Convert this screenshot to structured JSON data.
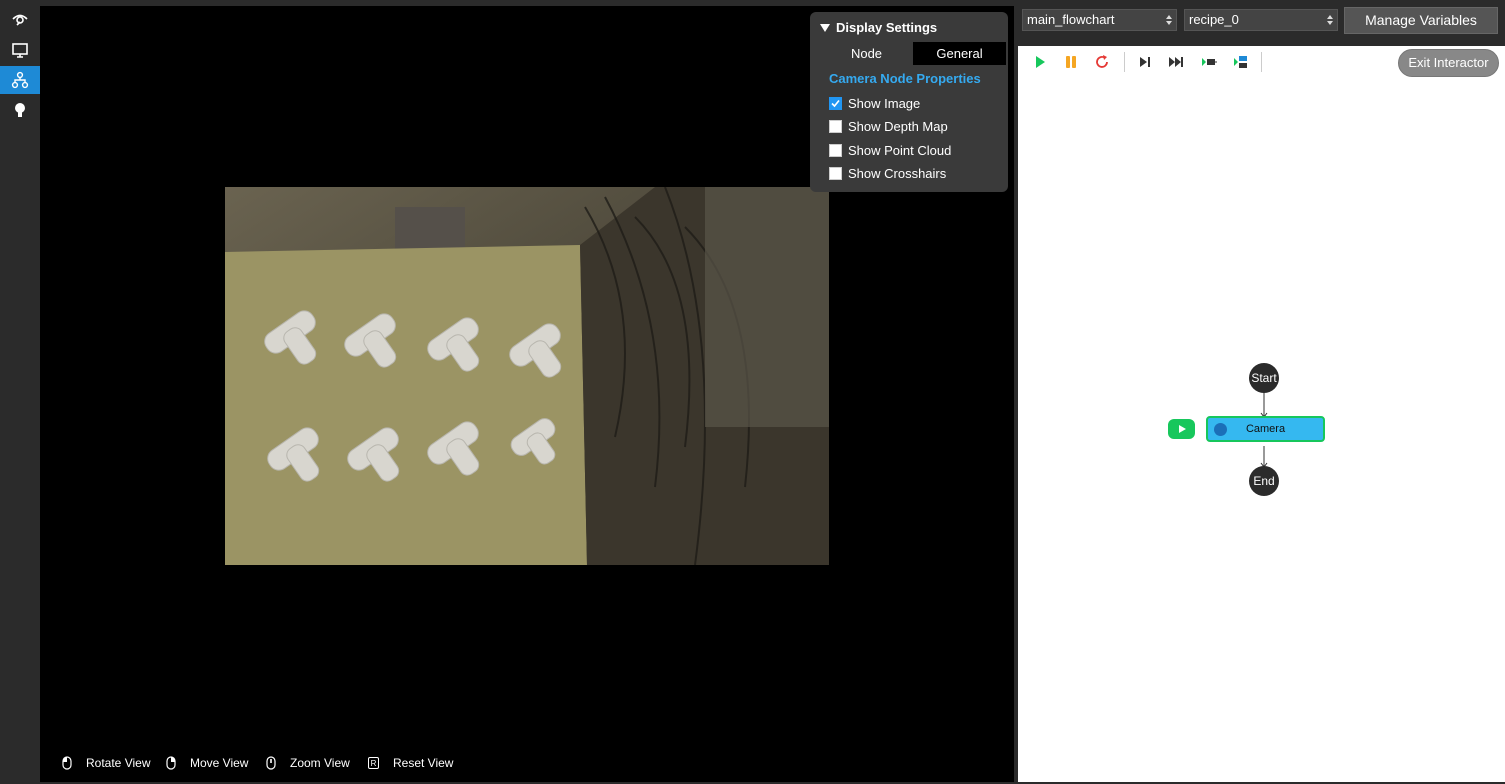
{
  "rail": {
    "items": [
      {
        "name": "vision-icon"
      },
      {
        "name": "monitor-icon"
      },
      {
        "name": "flowchart-icon",
        "active": true
      },
      {
        "name": "lightbulb-icon"
      }
    ]
  },
  "settings": {
    "title": "Display Settings",
    "tabs": [
      {
        "label": "Node",
        "selected": false
      },
      {
        "label": "General",
        "selected": true
      }
    ],
    "section_title": "Camera Node Properties",
    "options": [
      {
        "label": "Show Image",
        "checked": true
      },
      {
        "label": "Show Depth Map",
        "checked": false
      },
      {
        "label": "Show Point Cloud",
        "checked": false
      },
      {
        "label": "Show Crosshairs",
        "checked": false
      }
    ]
  },
  "hints": [
    {
      "icon": "mouse-left-icon",
      "label": "Rotate View"
    },
    {
      "icon": "mouse-right-icon",
      "label": "Move View"
    },
    {
      "icon": "mouse-scroll-icon",
      "label": "Zoom View"
    },
    {
      "icon": "key-r-icon",
      "label": "Reset View",
      "key": "R"
    }
  ],
  "header": {
    "flowchart_select": "main_flowchart",
    "recipe_select": "recipe_0",
    "manage_label": "Manage Variables"
  },
  "flow": {
    "exit_label": "Exit Interactor",
    "toolbar": [
      "play-icon",
      "pause-icon",
      "restart-icon",
      "step-icon",
      "fast-forward-icon",
      "run-to-node-icon",
      "run-selected-icon"
    ],
    "nodes": {
      "start": "Start",
      "camera": "Camera",
      "end": "End"
    }
  },
  "colors": {
    "accent": "#1e8ad6",
    "section": "#35aaf0",
    "node_fill": "#35b8f0",
    "node_border": "#17c75c",
    "play": "#17c75c",
    "pause": "#f5a623",
    "restart": "#e53935"
  }
}
